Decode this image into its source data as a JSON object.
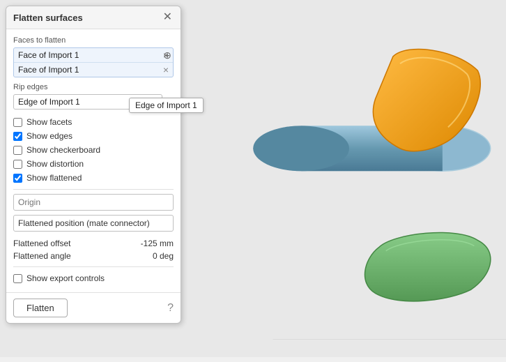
{
  "dialog": {
    "title": "Flatten surfaces",
    "sections": {
      "faces_to_flatten": {
        "label": "Faces to flatten",
        "items": [
          {
            "text": "Face of Import 1"
          },
          {
            "text": "Face of Import 1"
          }
        ]
      },
      "rip_edges": {
        "label": "Rip edges",
        "edge_text": "Edge of Import 1"
      },
      "tooltip": "Edge of Import 1",
      "checkboxes": [
        {
          "label": "Show facets",
          "checked": false,
          "name": "show-facets"
        },
        {
          "label": "Show edges",
          "checked": true,
          "name": "show-edges"
        },
        {
          "label": "Show checkerboard",
          "checked": false,
          "name": "show-checkerboard"
        },
        {
          "label": "Show distortion",
          "checked": false,
          "name": "show-distortion"
        },
        {
          "label": "Show flattened",
          "checked": true,
          "name": "show-flattened"
        }
      ],
      "origin_placeholder": "Origin",
      "mate_connector_label": "Flattened position (mate connector)",
      "flattened_offset_label": "Flattened offset",
      "flattened_offset_value": "-125 mm",
      "flattened_angle_label": "Flattened angle",
      "flattened_angle_value": "0 deg",
      "show_export_controls_label": "Show export controls"
    },
    "footer": {
      "flatten_label": "Flatten",
      "help_icon": "?"
    }
  }
}
